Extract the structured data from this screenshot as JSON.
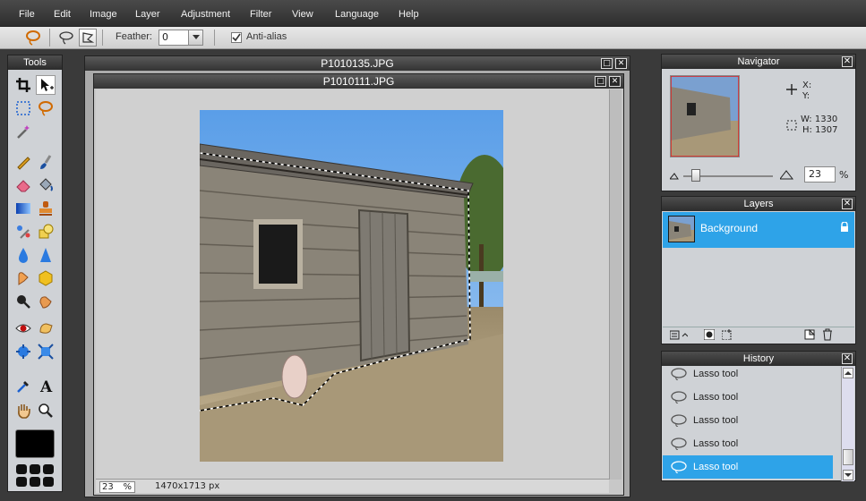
{
  "menu": [
    "File",
    "Edit",
    "Image",
    "Layer",
    "Adjustment",
    "Filter",
    "View",
    "Language",
    "Help"
  ],
  "options": {
    "feather_label": "Feather:",
    "feather_value": "0",
    "antialias_label": "Anti-alias",
    "antialias_checked": true
  },
  "tools_panel": {
    "title": "Tools",
    "primary_color": "#000000"
  },
  "documents": {
    "back_title": "P1010135.JPG",
    "front_title": "P1010111.JPG",
    "zoom": "23",
    "zoom_unit": "%",
    "dimensions": "1470x1713 px"
  },
  "navigator": {
    "title": "Navigator",
    "x_label": "X:",
    "y_label": "Y:",
    "w_label": "W: 1330",
    "h_label": "H: 1307",
    "zoom": "23",
    "zoom_unit": "%",
    "zoom_slider_fraction": 0.1
  },
  "layers": {
    "title": "Layers",
    "items": [
      {
        "name": "Background",
        "locked": true
      }
    ]
  },
  "history": {
    "title": "History",
    "items": [
      "Lasso tool",
      "Lasso tool",
      "Lasso tool",
      "Lasso tool",
      "Lasso tool"
    ],
    "active_index": 4
  }
}
